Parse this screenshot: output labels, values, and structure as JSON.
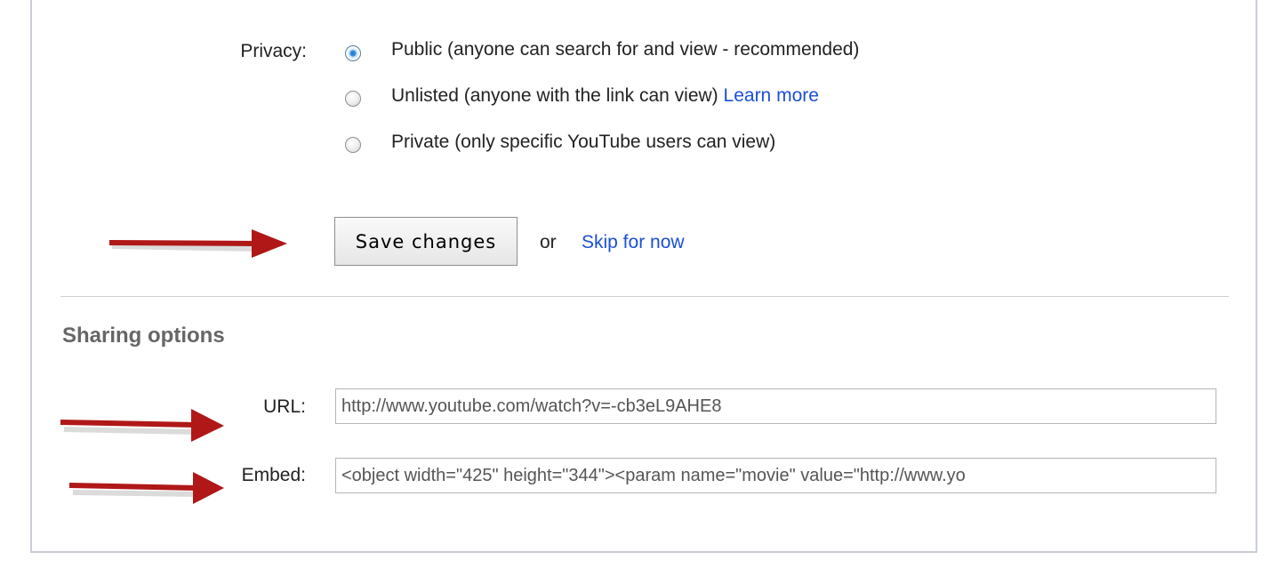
{
  "privacy": {
    "label": "Privacy:",
    "options": [
      {
        "text": "Public (anyone can search for and view - recommended)",
        "checked": true
      },
      {
        "text": "Unlisted (anyone with the link can view)",
        "checked": false,
        "link": "Learn more"
      },
      {
        "text": "Private (only specific YouTube users can view)",
        "checked": false
      }
    ]
  },
  "actions": {
    "save_label": "Save changes",
    "or_text": "or",
    "skip_label": "Skip for now"
  },
  "sharing": {
    "title": "Sharing options",
    "url_label": "URL:",
    "url_value": "http://www.youtube.com/watch?v=-cb3eL9AHE8",
    "embed_label": "Embed:",
    "embed_value": "<object width=\"425\" height=\"344\"><param name=\"movie\" value=\"http://www.yo"
  },
  "colors": {
    "link": "#1a4fd6",
    "arrow": "#b01818",
    "radio_selected": "#1f78c8"
  }
}
